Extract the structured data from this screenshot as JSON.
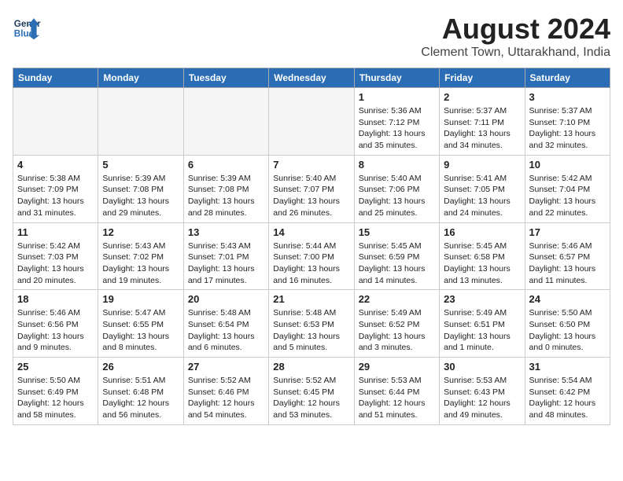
{
  "header": {
    "logo_line1": "General",
    "logo_line2": "Blue",
    "month_year": "August 2024",
    "location": "Clement Town, Uttarakhand, India"
  },
  "weekdays": [
    "Sunday",
    "Monday",
    "Tuesday",
    "Wednesday",
    "Thursday",
    "Friday",
    "Saturday"
  ],
  "weeks": [
    [
      {
        "day": "",
        "empty": true
      },
      {
        "day": "",
        "empty": true
      },
      {
        "day": "",
        "empty": true
      },
      {
        "day": "",
        "empty": true
      },
      {
        "day": "1",
        "sunrise": "5:36 AM",
        "sunset": "7:12 PM",
        "daylight": "13 hours and 35 minutes."
      },
      {
        "day": "2",
        "sunrise": "5:37 AM",
        "sunset": "7:11 PM",
        "daylight": "13 hours and 34 minutes."
      },
      {
        "day": "3",
        "sunrise": "5:37 AM",
        "sunset": "7:10 PM",
        "daylight": "13 hours and 32 minutes."
      }
    ],
    [
      {
        "day": "4",
        "sunrise": "5:38 AM",
        "sunset": "7:09 PM",
        "daylight": "13 hours and 31 minutes."
      },
      {
        "day": "5",
        "sunrise": "5:39 AM",
        "sunset": "7:08 PM",
        "daylight": "13 hours and 29 minutes."
      },
      {
        "day": "6",
        "sunrise": "5:39 AM",
        "sunset": "7:08 PM",
        "daylight": "13 hours and 28 minutes."
      },
      {
        "day": "7",
        "sunrise": "5:40 AM",
        "sunset": "7:07 PM",
        "daylight": "13 hours and 26 minutes."
      },
      {
        "day": "8",
        "sunrise": "5:40 AM",
        "sunset": "7:06 PM",
        "daylight": "13 hours and 25 minutes."
      },
      {
        "day": "9",
        "sunrise": "5:41 AM",
        "sunset": "7:05 PM",
        "daylight": "13 hours and 24 minutes."
      },
      {
        "day": "10",
        "sunrise": "5:42 AM",
        "sunset": "7:04 PM",
        "daylight": "13 hours and 22 minutes."
      }
    ],
    [
      {
        "day": "11",
        "sunrise": "5:42 AM",
        "sunset": "7:03 PM",
        "daylight": "13 hours and 20 minutes."
      },
      {
        "day": "12",
        "sunrise": "5:43 AM",
        "sunset": "7:02 PM",
        "daylight": "13 hours and 19 minutes."
      },
      {
        "day": "13",
        "sunrise": "5:43 AM",
        "sunset": "7:01 PM",
        "daylight": "13 hours and 17 minutes."
      },
      {
        "day": "14",
        "sunrise": "5:44 AM",
        "sunset": "7:00 PM",
        "daylight": "13 hours and 16 minutes."
      },
      {
        "day": "15",
        "sunrise": "5:45 AM",
        "sunset": "6:59 PM",
        "daylight": "13 hours and 14 minutes."
      },
      {
        "day": "16",
        "sunrise": "5:45 AM",
        "sunset": "6:58 PM",
        "daylight": "13 hours and 13 minutes."
      },
      {
        "day": "17",
        "sunrise": "5:46 AM",
        "sunset": "6:57 PM",
        "daylight": "13 hours and 11 minutes."
      }
    ],
    [
      {
        "day": "18",
        "sunrise": "5:46 AM",
        "sunset": "6:56 PM",
        "daylight": "13 hours and 9 minutes."
      },
      {
        "day": "19",
        "sunrise": "5:47 AM",
        "sunset": "6:55 PM",
        "daylight": "13 hours and 8 minutes."
      },
      {
        "day": "20",
        "sunrise": "5:48 AM",
        "sunset": "6:54 PM",
        "daylight": "13 hours and 6 minutes."
      },
      {
        "day": "21",
        "sunrise": "5:48 AM",
        "sunset": "6:53 PM",
        "daylight": "13 hours and 5 minutes."
      },
      {
        "day": "22",
        "sunrise": "5:49 AM",
        "sunset": "6:52 PM",
        "daylight": "13 hours and 3 minutes."
      },
      {
        "day": "23",
        "sunrise": "5:49 AM",
        "sunset": "6:51 PM",
        "daylight": "13 hours and 1 minute."
      },
      {
        "day": "24",
        "sunrise": "5:50 AM",
        "sunset": "6:50 PM",
        "daylight": "13 hours and 0 minutes."
      }
    ],
    [
      {
        "day": "25",
        "sunrise": "5:50 AM",
        "sunset": "6:49 PM",
        "daylight": "12 hours and 58 minutes."
      },
      {
        "day": "26",
        "sunrise": "5:51 AM",
        "sunset": "6:48 PM",
        "daylight": "12 hours and 56 minutes."
      },
      {
        "day": "27",
        "sunrise": "5:52 AM",
        "sunset": "6:46 PM",
        "daylight": "12 hours and 54 minutes."
      },
      {
        "day": "28",
        "sunrise": "5:52 AM",
        "sunset": "6:45 PM",
        "daylight": "12 hours and 53 minutes."
      },
      {
        "day": "29",
        "sunrise": "5:53 AM",
        "sunset": "6:44 PM",
        "daylight": "12 hours and 51 minutes."
      },
      {
        "day": "30",
        "sunrise": "5:53 AM",
        "sunset": "6:43 PM",
        "daylight": "12 hours and 49 minutes."
      },
      {
        "day": "31",
        "sunrise": "5:54 AM",
        "sunset": "6:42 PM",
        "daylight": "12 hours and 48 minutes."
      }
    ]
  ]
}
